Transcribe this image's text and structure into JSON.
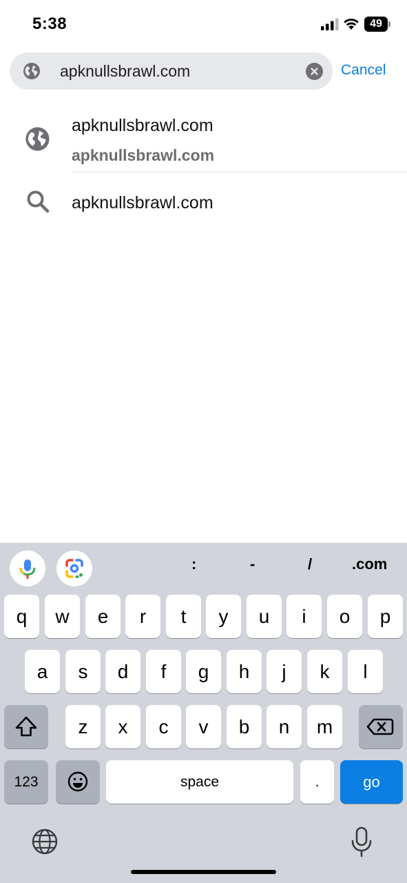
{
  "status_bar": {
    "time": "5:38",
    "battery_level": "49"
  },
  "search": {
    "value": "apknullsbrawl.com",
    "cancel_label": "Cancel"
  },
  "suggestions": [
    {
      "type": "site",
      "icon": "globe-icon",
      "title": "apknullsbrawl.com",
      "subtitle": "apknullsbrawl.com"
    },
    {
      "type": "search",
      "icon": "search-icon",
      "title": "apknullsbrawl.com"
    }
  ],
  "keyboard": {
    "quick_keys": [
      ":",
      "-",
      "/",
      ".com"
    ],
    "row1": [
      "q",
      "w",
      "e",
      "r",
      "t",
      "y",
      "u",
      "i",
      "o",
      "p"
    ],
    "row2": [
      "a",
      "s",
      "d",
      "f",
      "g",
      "h",
      "j",
      "k",
      "l"
    ],
    "row3": [
      "z",
      "x",
      "c",
      "v",
      "b",
      "n",
      "m"
    ],
    "numbers_label": "123",
    "space_label": "space",
    "period_label": ".",
    "go_label": "go"
  },
  "colors": {
    "accent": "#0a7ee3",
    "keyboard_bg": "#d1d4da",
    "search_bg": "#e7e8eb"
  }
}
